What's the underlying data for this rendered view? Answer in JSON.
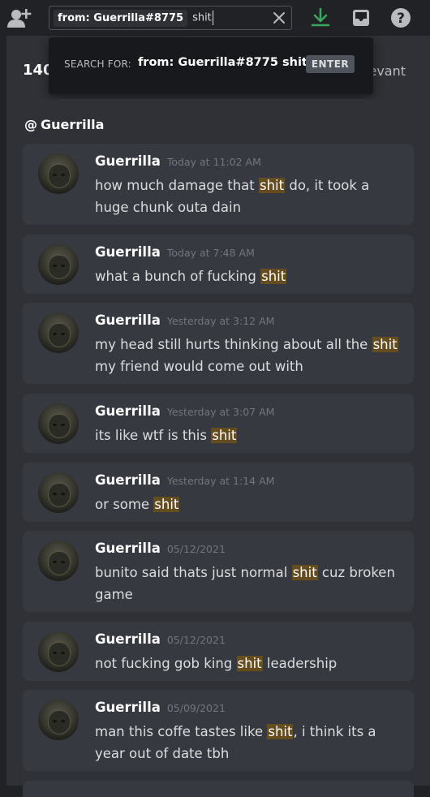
{
  "search": {
    "filter_chip": "from: Guerrilla#8775",
    "query": "shit"
  },
  "popout": {
    "label": "SEARCH FOR:",
    "query": "from: Guerrilla#8775 shit",
    "enter_label": "ENTER"
  },
  "results": {
    "count": "140",
    "sort_fragment": "evant"
  },
  "channel": {
    "at": "@",
    "name": "Guerrilla"
  },
  "messages": [
    {
      "author": "Guerrilla",
      "time": "Today at 11:02 AM",
      "pre": "how much damage that ",
      "hit": "shit",
      "post": " do, it took a huge chunk outa dain"
    },
    {
      "author": "Guerrilla",
      "time": "Today at 7:48 AM",
      "pre": "what a bunch of fucking ",
      "hit": "shit",
      "post": ""
    },
    {
      "author": "Guerrilla",
      "time": "Yesterday at 3:12 AM",
      "pre": "my head still hurts thinking about all the ",
      "hit": "shit",
      "post": " my friend would come out with"
    },
    {
      "author": "Guerrilla",
      "time": "Yesterday at 3:07 AM",
      "pre": "its like wtf is this ",
      "hit": "shit",
      "post": ""
    },
    {
      "author": "Guerrilla",
      "time": "Yesterday at 1:14 AM",
      "pre": "or some ",
      "hit": "shit",
      "post": ""
    },
    {
      "author": "Guerrilla",
      "time": "05/12/2021",
      "pre": "bunito said thats just normal ",
      "hit": "shit",
      "post": " cuz broken game"
    },
    {
      "author": "Guerrilla",
      "time": "05/12/2021",
      "pre": "not fucking gob king ",
      "hit": "shit",
      "post": " leadership"
    },
    {
      "author": "Guerrilla",
      "time": "05/09/2021",
      "pre": "man this coffe tastes like ",
      "hit": "shit",
      "post": ", i think its a year out of date tbh"
    }
  ]
}
